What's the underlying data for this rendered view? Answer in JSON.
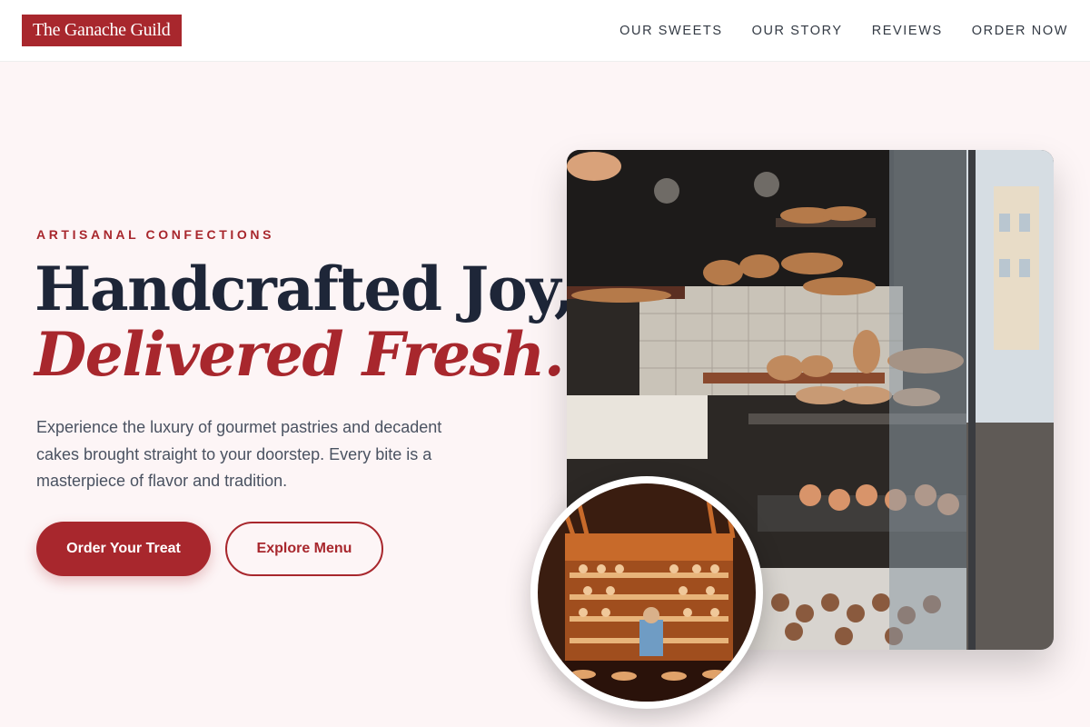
{
  "brand": {
    "name": "The Ganache Guild",
    "color": "#a8272d"
  },
  "nav": {
    "items": [
      "OUR SWEETS",
      "OUR STORY",
      "REVIEWS",
      "ORDER NOW"
    ]
  },
  "hero": {
    "eyebrow": "ARTISANAL CONFECTIONS",
    "headline_line1": "Handcrafted Joy,",
    "headline_line2": "Delivered Fresh.",
    "description": "Experience the luxury of gourmet pastries and decadent cakes brought straight to your doorstep. Every bite is a masterpiece of flavor and tradition.",
    "primary_cta": "Order Your Treat",
    "secondary_cta": "Explore Menu"
  },
  "images": {
    "main_photo": "bakery-display-window-photo",
    "badge_photo": "bakery-counter-shelves-photo"
  }
}
